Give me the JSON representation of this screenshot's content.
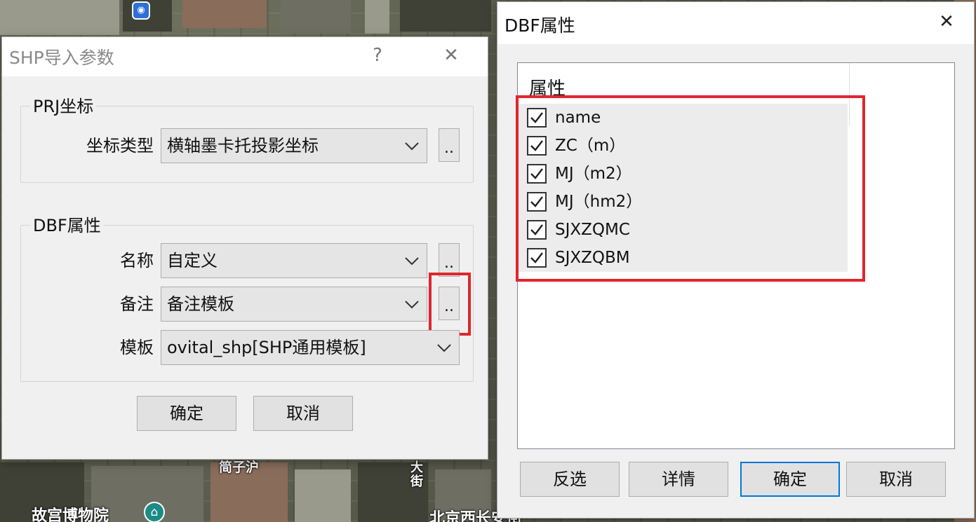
{
  "map": {
    "labels": [
      "简子沪",
      "故宫博物院",
      "大街",
      "北京西长安街"
    ]
  },
  "shp_dialog": {
    "title": "SHP导入参数",
    "help_symbol": "?",
    "close_symbol": "✕",
    "prj_group": {
      "legend": "PRJ坐标",
      "coord_type_label": "坐标类型",
      "coord_type_value": "横轴墨卡托投影坐标",
      "more_label": ".."
    },
    "dbf_group": {
      "legend": "DBF属性",
      "name_label": "名称",
      "name_value": "自定义",
      "remark_label": "备注",
      "remark_value": "备注模板",
      "template_label": "模板",
      "template_value": "ovital_shp[SHP通用模板]",
      "more_label": ".."
    },
    "ok_label": "确定",
    "cancel_label": "取消"
  },
  "dbf_dialog": {
    "title": "DBF属性",
    "close_symbol": "✕",
    "list_header": "属性",
    "items": [
      {
        "label": "name",
        "checked": true
      },
      {
        "label": "ZC（m）",
        "checked": true
      },
      {
        "label": "MJ（m2）",
        "checked": true
      },
      {
        "label": "MJ（hm2）",
        "checked": true
      },
      {
        "label": "SJXZQMC",
        "checked": true
      },
      {
        "label": "SJXZQBM",
        "checked": true
      }
    ],
    "buttons": {
      "invert": "反选",
      "details": "详情",
      "ok": "确定",
      "cancel": "取消"
    }
  },
  "colors": {
    "highlight_red": "#e0262e",
    "focus_blue": "#0078d7"
  }
}
